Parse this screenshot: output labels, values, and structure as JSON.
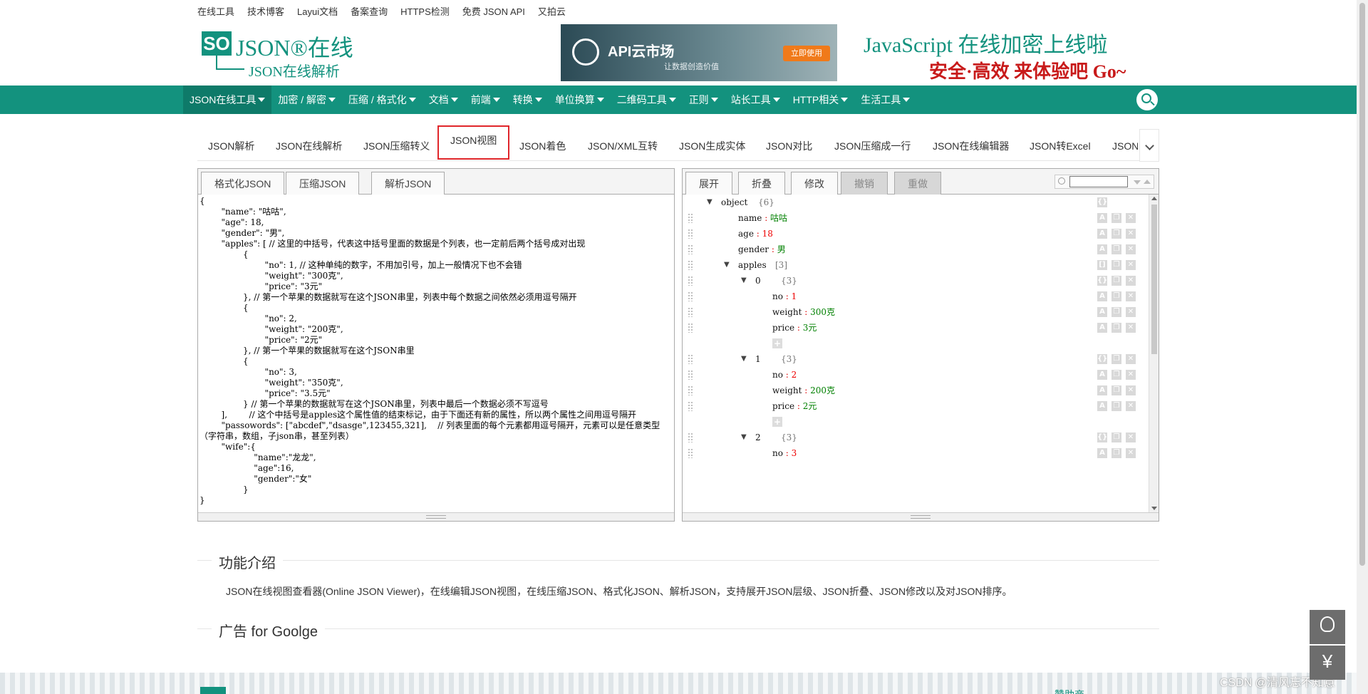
{
  "top_links": [
    "在线工具",
    "技术博客",
    "Layui文档",
    "备案查询",
    "HTTPS检测",
    "免费 JSON API",
    "又拍云"
  ],
  "logo": {
    "badge": "SO",
    "brand": "JSON®在线",
    "subtitle": "JSON在线解析"
  },
  "ad_banner": {
    "title": "API云市场",
    "tagline": "让数据创造价值",
    "button": "立即使用"
  },
  "promo": {
    "line1": "JavaScript 在线加密上线啦",
    "line2": "安全·高效 来体验吧 Go~"
  },
  "nav": {
    "items": [
      "JSON在线工具",
      "加密 / 解密",
      "压缩 / 格式化",
      "文档",
      "前端",
      "转换",
      "单位换算",
      "二维码工具",
      "正则",
      "站长工具",
      "HTTP相关",
      "生活工具"
    ],
    "active_index": 0
  },
  "tool_tabs": [
    "JSON解析",
    "JSON在线解析",
    "JSON压缩转义",
    "JSON视图",
    "JSON着色",
    "JSON/XML互转",
    "JSON生成实体",
    "JSON对比",
    "JSON压缩成一行",
    "JSON在线编辑器",
    "JSON转Excel",
    "JSON"
  ],
  "selected_tool_tab": "JSON视图",
  "left_tabs": [
    "格式化JSON",
    "压缩JSON",
    "解析JSON"
  ],
  "right_tabs": {
    "enabled": [
      "展开",
      "折叠",
      "修改"
    ],
    "disabled": [
      "撤销",
      "重做"
    ]
  },
  "code_lines": [
    "{",
    "        \"name\": \"咕咕\",",
    "        \"age\": 18,",
    "        \"gender\": \"男\",",
    "        \"apples\": [ // 这里的中括号，代表这中括号里面的数据是个列表，也一定前后两个括号成对出现",
    "                {",
    "                        \"no\": 1, // 这种单纯的数字，不用加引号，加上一般情况下也不会错",
    "                        \"weight\": \"300克\",",
    "                        \"price\": \"3元\"",
    "                }, // 第一个苹果的数据就写在这个JSON串里，列表中每个数据之间依然必须用逗号隔开",
    "                {",
    "                        \"no\": 2,",
    "                        \"weight\": \"200克\",",
    "                        \"price\": \"2元\"",
    "                }, // 第一个苹果的数据就写在这个JSON串里",
    "                {",
    "                        \"no\": 3,",
    "                        \"weight\": \"350克\",",
    "                        \"price\": \"3.5元\"",
    "                } // 第一个苹果的数据就写在这个JSON串里，列表中最后一个数据必须不写逗号",
    "        ],        // 这个中括号是apples这个属性值的结束标记，由于下面还有新的属性，所以两个属性之间用逗号隔开",
    "        \"passowords\": [\"abcdef\",\"dsasge\",123455,321],    // 列表里面的每个元素都用逗号隔开，元素可以是任意类型（字符串，数组，子json串，甚至列表）",
    "        \"wife\":{",
    "                    \"name\":\"龙龙\",",
    "                    \"age\":16,",
    "                    \"gender\":\"女\"",
    "                }",
    "}"
  ],
  "tree": {
    "root_label": "object",
    "root_count": "{6}",
    "name_key": "name",
    "name_val": "咕咕",
    "age_key": "age",
    "age_val": "18",
    "gender_key": "gender",
    "gender_val": "男",
    "apples_key": "apples",
    "apples_count": "[3]",
    "item0_idx": "0",
    "item0_count": "{3}",
    "item0_no": "1",
    "item0_weight": "300克",
    "item0_price": "3元",
    "item1_idx": "1",
    "item1_count": "{3}",
    "item1_no": "2",
    "item1_weight": "200克",
    "item1_price": "2元",
    "item2_idx": "2",
    "item2_count": "{3}",
    "item2_no": "3",
    "k_no": "no",
    "k_weight": "weight",
    "k_price": "price"
  },
  "section_intro": {
    "title": "功能介绍",
    "text": "JSON在线视图查看器(Online JSON Viewer)，在线编辑JSON视图，在线压缩JSON、格式化JSON、解析JSON，支持展开JSON层级、JSON折叠、JSON修改以及对JSON排序。"
  },
  "section_ads": {
    "title": "广告 for Goolge"
  },
  "footer": {
    "right_text": "赞助商"
  },
  "watermark": "CSDN @清风忘不知意",
  "colors": {
    "brand": "#13927e",
    "highlight": "#e0262b",
    "string": "#008000",
    "number": "#ee0000"
  }
}
